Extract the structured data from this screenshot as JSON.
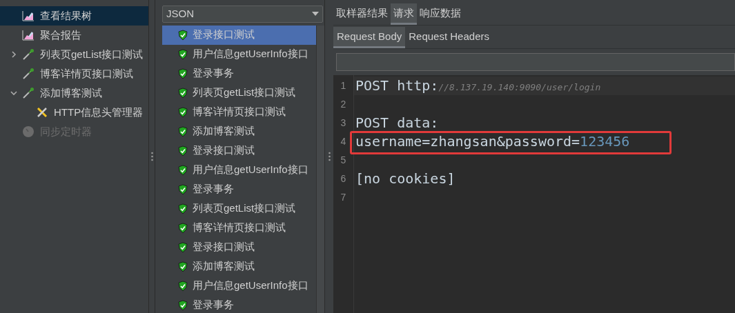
{
  "tree": [
    {
      "label": "查看结果树",
      "kind": "chart",
      "selected": true,
      "disabled": false
    },
    {
      "label": "聚合报告",
      "kind": "chart",
      "selected": false,
      "disabled": false
    },
    {
      "label": "列表页getList接口测试",
      "kind": "pipette",
      "selected": false,
      "disabled": false,
      "expanded": false
    },
    {
      "label": "博客详情页接口测试",
      "kind": "pipette",
      "selected": false,
      "disabled": false
    },
    {
      "label": "添加博客测试",
      "kind": "pipette",
      "selected": false,
      "disabled": false,
      "expanded": true,
      "children": [
        {
          "label": "HTTP信息头管理器",
          "kind": "tools",
          "selected": false,
          "disabled": false
        }
      ]
    },
    {
      "label": "同步定时器",
      "kind": "timer",
      "selected": false,
      "disabled": true
    }
  ],
  "renderer": {
    "value": "JSON"
  },
  "results": [
    {
      "label": "登录接口测试",
      "selected": true
    },
    {
      "label": "用户信息getUserInfo接口",
      "selected": false
    },
    {
      "label": "登录事务",
      "selected": false
    },
    {
      "label": "列表页getList接口测试",
      "selected": false
    },
    {
      "label": "博客详情页接口测试",
      "selected": false
    },
    {
      "label": "添加博客测试",
      "selected": false
    },
    {
      "label": "登录接口测试",
      "selected": false
    },
    {
      "label": "用户信息getUserInfo接口",
      "selected": false
    },
    {
      "label": "登录事务",
      "selected": false
    },
    {
      "label": "列表页getList接口测试",
      "selected": false
    },
    {
      "label": "博客详情页接口测试",
      "selected": false
    },
    {
      "label": "登录接口测试",
      "selected": false
    },
    {
      "label": "添加博客测试",
      "selected": false
    },
    {
      "label": "用户信息getUserInfo接口",
      "selected": false
    },
    {
      "label": "登录事务",
      "selected": false
    }
  ],
  "tabs": [
    {
      "label": "取样器结果",
      "selected": false
    },
    {
      "label": "请求",
      "selected": true
    },
    {
      "label": "响应数据",
      "selected": false
    }
  ],
  "sub_tabs": [
    {
      "label": "Request Body",
      "selected": true
    },
    {
      "label": "Request Headers",
      "selected": false
    }
  ],
  "editor": {
    "lines": [
      {
        "number": "1",
        "parts": [
          {
            "kind": "plain",
            "text": "POST http:"
          },
          {
            "kind": "comment",
            "text": "//8.137.19.140:9090/user/login"
          }
        ]
      },
      {
        "number": "2"
      },
      {
        "number": "3",
        "parts": [
          {
            "kind": "plain",
            "text": "POST data:"
          }
        ]
      },
      {
        "number": "4",
        "highlighted": true,
        "parts": [
          {
            "kind": "plain",
            "text": "username=zhangsan&password="
          },
          {
            "kind": "number",
            "text": "123456"
          }
        ]
      },
      {
        "number": "5"
      },
      {
        "number": "6",
        "parts": [
          {
            "kind": "plain",
            "text": "[no cookies]"
          }
        ]
      },
      {
        "number": "7"
      }
    ]
  }
}
